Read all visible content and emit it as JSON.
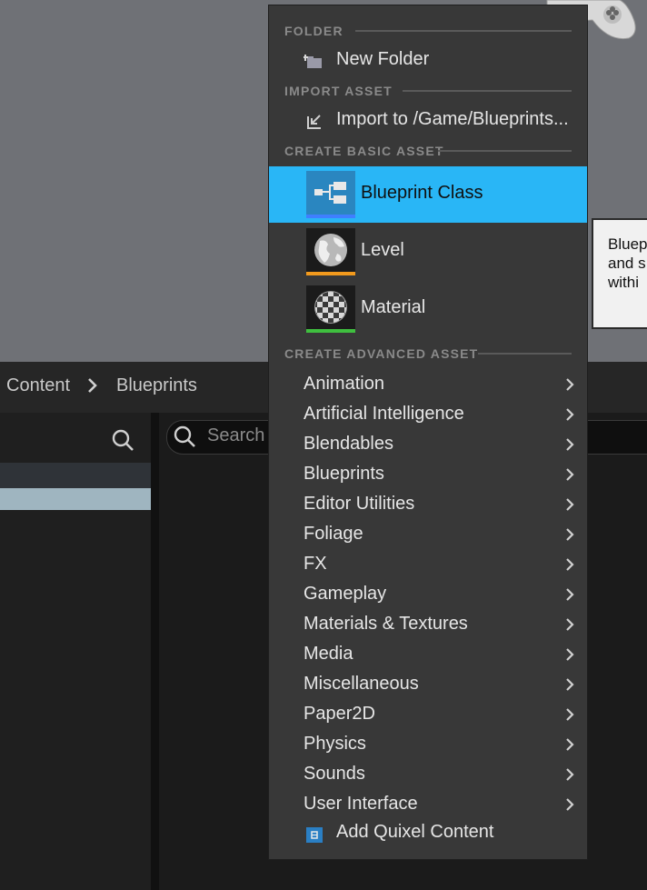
{
  "menu": {
    "sections": {
      "folder": "FOLDER",
      "import_asset": "IMPORT ASSET",
      "create_basic": "CREATE BASIC ASSET",
      "create_advanced": "CREATE ADVANCED ASSET"
    },
    "new_folder": "New Folder",
    "import": "Import to /Game/Blueprints...",
    "basic_assets": [
      {
        "label": "Blueprint Class",
        "icon": "blueprint-class-icon",
        "accent": "#3f7fff"
      },
      {
        "label": "Level",
        "icon": "globe-icon",
        "accent": "#f29a1d"
      },
      {
        "label": "Material",
        "icon": "checker-sphere-icon",
        "accent": "#3fbf3f"
      }
    ],
    "advanced": [
      "Animation",
      "Artificial Intelligence",
      "Blendables",
      "Blueprints",
      "Editor Utilities",
      "Foliage",
      "FX",
      "Gameplay",
      "Materials & Textures",
      "Media",
      "Miscellaneous",
      "Paper2D",
      "Physics",
      "Sounds",
      "User Interface"
    ],
    "quixel": "Add Quixel Content"
  },
  "tooltip": {
    "lines": [
      "Bluep",
      "and s",
      "withi"
    ]
  },
  "breadcrumb": {
    "items": [
      "Content",
      "Blueprints"
    ]
  },
  "search": {
    "placeholder": "Search"
  },
  "colors": {
    "highlight": "#29b6f6",
    "menu_bg": "#383838",
    "viewport_bg": "#6f7176"
  }
}
